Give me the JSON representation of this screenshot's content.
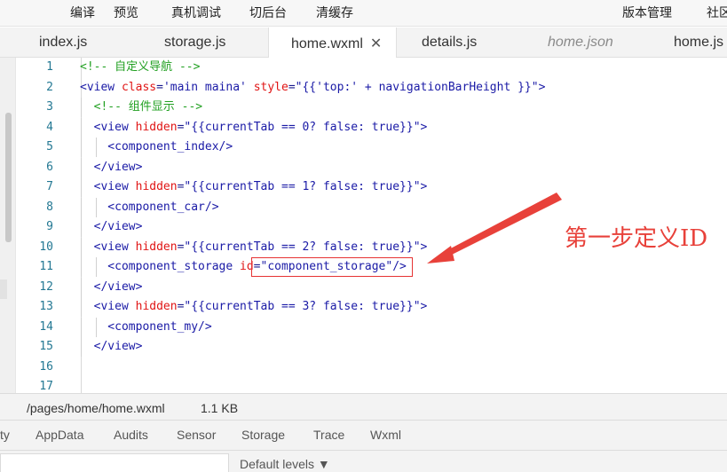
{
  "toolbar": {
    "items": [
      "编译",
      "预览",
      "真机调试",
      "切后台",
      "清缓存",
      "版本管理",
      "社区"
    ]
  },
  "tabs": [
    {
      "label": "index.js",
      "state": "normal"
    },
    {
      "label": "storage.js",
      "state": "normal"
    },
    {
      "label": "home.wxml",
      "state": "active",
      "close": "✕"
    },
    {
      "label": "details.js",
      "state": "normal"
    },
    {
      "label": "home.json",
      "state": "preview"
    },
    {
      "label": "home.js",
      "state": "normal"
    }
  ],
  "editor": {
    "lines": [
      {
        "n": "1",
        "segments": [
          {
            "c": "cm",
            "t": "<!-- 自定义导航 -->"
          }
        ]
      },
      {
        "n": "2",
        "segments": [
          {
            "c": "tag",
            "t": "<view "
          },
          {
            "c": "attr",
            "t": "class"
          },
          {
            "c": "plain",
            "t": "="
          },
          {
            "c": "str",
            "t": "'main maina'"
          },
          {
            "c": "plain",
            "t": " "
          },
          {
            "c": "attr",
            "t": "style"
          },
          {
            "c": "plain",
            "t": "="
          },
          {
            "c": "str",
            "t": "\"{{'top:' + navigationBarHeight }}\""
          },
          {
            "c": "tag",
            "t": ">"
          }
        ]
      },
      {
        "n": "3",
        "segments": [
          {
            "c": "cm",
            "t": "  <!-- 组件显示 -->"
          }
        ]
      },
      {
        "n": "4",
        "segments": [
          {
            "c": "tag",
            "t": "  <view "
          },
          {
            "c": "attr",
            "t": "hidden"
          },
          {
            "c": "plain",
            "t": "="
          },
          {
            "c": "str",
            "t": "\"{{currentTab == 0? false: true}}\""
          },
          {
            "c": "tag",
            "t": ">"
          }
        ]
      },
      {
        "n": "5",
        "segments": [
          {
            "c": "tag",
            "t": "    <component_index/>"
          }
        ]
      },
      {
        "n": "6",
        "segments": [
          {
            "c": "tag",
            "t": "  </view>"
          }
        ]
      },
      {
        "n": "7",
        "segments": [
          {
            "c": "tag",
            "t": "  <view "
          },
          {
            "c": "attr",
            "t": "hidden"
          },
          {
            "c": "plain",
            "t": "="
          },
          {
            "c": "str",
            "t": "\"{{currentTab == 1? false: true}}\""
          },
          {
            "c": "tag",
            "t": ">"
          }
        ]
      },
      {
        "n": "8",
        "segments": [
          {
            "c": "tag",
            "t": "    <component_car/>"
          }
        ]
      },
      {
        "n": "9",
        "segments": [
          {
            "c": "tag",
            "t": "  </view>"
          }
        ]
      },
      {
        "n": "10",
        "segments": [
          {
            "c": "tag",
            "t": "  <view "
          },
          {
            "c": "attr",
            "t": "hidden"
          },
          {
            "c": "plain",
            "t": "="
          },
          {
            "c": "str",
            "t": "\"{{currentTab == 2? false: true}}\""
          },
          {
            "c": "tag",
            "t": ">"
          }
        ]
      },
      {
        "n": "11",
        "segments": [
          {
            "c": "tag",
            "t": "    <component_storage "
          },
          {
            "c": "attr",
            "t": "id"
          },
          {
            "c": "plain",
            "t": "="
          },
          {
            "c": "str",
            "t": "\"component_storage\""
          },
          {
            "c": "tag",
            "t": "/>"
          }
        ]
      },
      {
        "n": "12",
        "segments": [
          {
            "c": "tag",
            "t": "  </view>"
          }
        ]
      },
      {
        "n": "13",
        "segments": [
          {
            "c": "tag",
            "t": "  <view "
          },
          {
            "c": "attr",
            "t": "hidden"
          },
          {
            "c": "plain",
            "t": "="
          },
          {
            "c": "str",
            "t": "\"{{currentTab == 3? false: true}}\""
          },
          {
            "c": "tag",
            "t": ">"
          }
        ]
      },
      {
        "n": "14",
        "segments": [
          {
            "c": "tag",
            "t": "    <component_my/>"
          }
        ]
      },
      {
        "n": "15",
        "segments": [
          {
            "c": "tag",
            "t": "  </view>"
          }
        ]
      },
      {
        "n": "16",
        "segments": []
      },
      {
        "n": "17",
        "segments": []
      }
    ],
    "annotation": "第一步定义ID"
  },
  "status": {
    "path": "/pages/home/home.wxml",
    "size": "1.1 KB"
  },
  "devtools": {
    "tabs": [
      "ty",
      "AppData",
      "Audits",
      "Sensor",
      "Storage",
      "Trace",
      "Wxml"
    ]
  },
  "console": {
    "levels": "Default levels ▼"
  },
  "colors": {
    "comment": "#22a022",
    "tag": "#1a1aa6",
    "attribute": "#e01515",
    "string": "#1a1aa6",
    "annotation": "#e8413a"
  }
}
